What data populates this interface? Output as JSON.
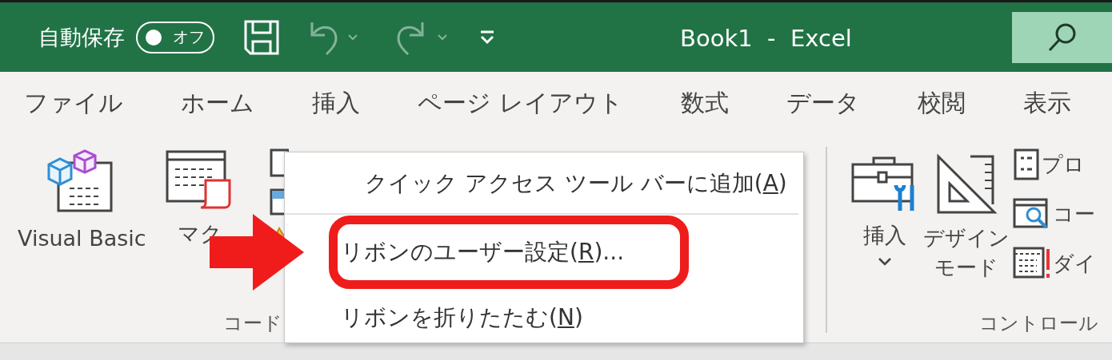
{
  "title_bar": {
    "autosave_label": "自動保存",
    "autosave": {
      "on": false,
      "label": "オフ"
    },
    "title": "Book1  -  Excel"
  },
  "tabs": [
    {
      "label": "ファイル",
      "selected": false
    },
    {
      "label": "ホーム",
      "selected": false
    },
    {
      "label": "挿入",
      "selected": false
    },
    {
      "label": "ページ レイアウト",
      "selected": false
    },
    {
      "label": "数式",
      "selected": false
    },
    {
      "label": "データ",
      "selected": false
    },
    {
      "label": "校閲",
      "selected": false
    },
    {
      "label": "表示",
      "selected": false
    }
  ],
  "ribbon": {
    "code_group": {
      "label": "コード",
      "buttons": [
        {
          "kind": "vba",
          "label": "Visual Basic"
        },
        {
          "kind": "macro",
          "label": "マク"
        }
      ]
    },
    "controls_group": {
      "label": "コントロール",
      "insert": {
        "label": "挿入"
      },
      "design_mode": {
        "label_lines": [
          "デザイン",
          "モード"
        ]
      },
      "small_items": [
        {
          "kind": "properties",
          "label": "プロ"
        },
        {
          "kind": "code",
          "label": "コー"
        },
        {
          "kind": "dialog",
          "label": "ダイ"
        }
      ]
    }
  },
  "context_menu": {
    "items": [
      {
        "before": "クイック アクセス ツール バーに追加(",
        "key": "A",
        "after": ")",
        "highlighted": false
      },
      {
        "before": "リボンのユーザー設定(",
        "key": "R",
        "after": ")...",
        "highlighted": true
      },
      {
        "before": "リボンを折りたたむ(",
        "key": "N",
        "after": ")",
        "highlighted": false
      }
    ]
  }
}
